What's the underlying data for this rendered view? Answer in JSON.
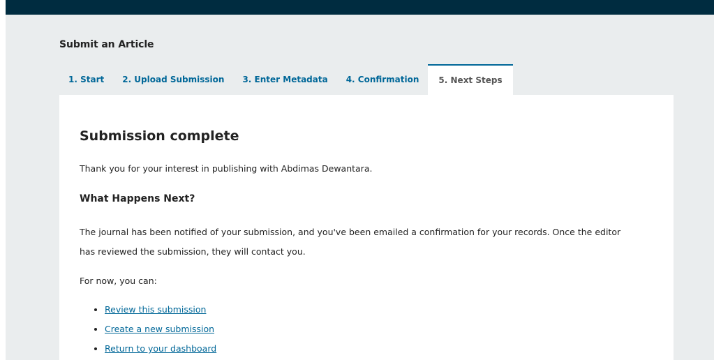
{
  "header": {
    "page_title": "Submit an Article"
  },
  "tabs": [
    {
      "label": "1. Start",
      "active": false
    },
    {
      "label": "2. Upload Submission",
      "active": false
    },
    {
      "label": "3. Enter Metadata",
      "active": false
    },
    {
      "label": "4. Confirmation",
      "active": false
    },
    {
      "label": "5. Next Steps",
      "active": true
    }
  ],
  "main": {
    "heading": "Submission complete",
    "thanks": "Thank you for your interest in publishing with Abdimas Dewantara.",
    "subheading": "What Happens Next?",
    "notified": "The journal has been notified of your submission, and you've been emailed a confirmation for your records. Once the editor has reviewed the submission, they will contact you.",
    "for_now": "For now, you can:",
    "links": [
      {
        "label": "Review this submission"
      },
      {
        "label": "Create a new submission"
      },
      {
        "label": "Return to your dashboard"
      }
    ]
  },
  "colors": {
    "topbar": "#002c40",
    "background": "#eaedee",
    "link": "#006798",
    "text": "#222222"
  }
}
